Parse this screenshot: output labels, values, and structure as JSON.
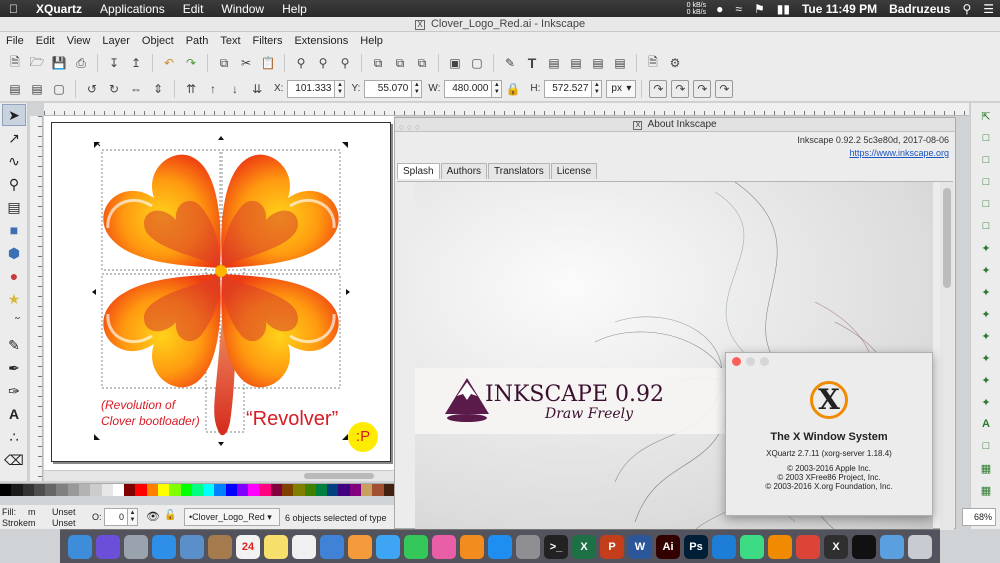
{
  "mac_menubar": {
    "apple_icon": "apple-logo-icon",
    "app_name": "XQuartz",
    "items": [
      "Applications",
      "Edit",
      "Window",
      "Help"
    ],
    "net_up": "0 kB/s",
    "net_down": "0 kB/s",
    "datetime": "Tue 11:49 PM",
    "user": "Badruzeus"
  },
  "window_title": "Clover_Logo_Red.ai - Inkscape",
  "menu": [
    "File",
    "Edit",
    "View",
    "Layer",
    "Object",
    "Path",
    "Text",
    "Filters",
    "Extensions",
    "Help"
  ],
  "controls": {
    "x_label": "X:",
    "x_value": "101.333",
    "y_label": "Y:",
    "y_value": "55.070",
    "w_label": "W:",
    "w_value": "480.000",
    "h_label": "H:",
    "h_value": "572.527",
    "unit": "px"
  },
  "canvas": {
    "caption_line1": "(Revolution of",
    "caption_line2": "Clover bootloader)",
    "revolver": "“Revolver”",
    "smiley": ":P",
    "colors": {
      "petal_outer": "#f03e14",
      "petal_inner": "#ffc107",
      "text_red": "#d81b25",
      "smiley_bg": "#ffeb00"
    }
  },
  "statusbar": {
    "fill_label": "Fill:",
    "fill_value": "m",
    "fill_unset": "Unset",
    "stroke_label": "Stroke:",
    "stroke_value": "m",
    "stroke_unset": "Unset",
    "opacity_label": "O:",
    "opacity_value": "0",
    "layer": "•Clover_Logo_Red",
    "message": "6 objects selected of type"
  },
  "zoom": "68%",
  "about": {
    "title": "About Inkscape",
    "version": "Inkscape 0.92.2 5c3e80d, 2017-08-06",
    "url": "https://www.inkscape.org",
    "tabs": [
      "Splash",
      "Authors",
      "Translators",
      "License"
    ],
    "splash_name": "INKSCAPE 0.92",
    "splash_tagline": "Draw Freely"
  },
  "xquartz": {
    "title": "The X Window System",
    "version": "XQuartz 2.7.11 (xorg-server 1.18.4)",
    "copyright1": "© 2003-2016 Apple Inc.",
    "copyright2": "© 2003 XFree86 Project, Inc.",
    "copyright3": "© 2003-2016 X.org Foundation, Inc."
  },
  "dock": [
    {
      "name": "finder-icon",
      "label": "",
      "color": "#3d8ddb"
    },
    {
      "name": "siri-icon",
      "label": "",
      "color": "#6b4fd8"
    },
    {
      "name": "launchpad-icon",
      "label": "",
      "color": "#9aa2ad"
    },
    {
      "name": "safari-icon",
      "label": "",
      "color": "#2d8fe8"
    },
    {
      "name": "preview-icon",
      "label": "",
      "color": "#5a8fc9"
    },
    {
      "name": "contacts-icon",
      "label": "",
      "color": "#a57b4e"
    },
    {
      "name": "calendar-icon",
      "label": "24",
      "color": "#f2f2f2"
    },
    {
      "name": "notes-icon",
      "label": "",
      "color": "#f6e06b"
    },
    {
      "name": "reminders-icon",
      "label": "",
      "color": "#f0f0f0"
    },
    {
      "name": "keynote-icon",
      "label": "",
      "color": "#3f82d6"
    },
    {
      "name": "photos-icon",
      "label": "",
      "color": "#f59a3b"
    },
    {
      "name": "messages-icon",
      "label": "",
      "color": "#3da5f4"
    },
    {
      "name": "facetime-icon",
      "label": "",
      "color": "#34c759"
    },
    {
      "name": "itunes-icon",
      "label": "",
      "color": "#e85fa8"
    },
    {
      "name": "ibooks-icon",
      "label": "",
      "color": "#f28c1e"
    },
    {
      "name": "appstore-icon",
      "label": "",
      "color": "#1f8ef1"
    },
    {
      "name": "system-preferences-icon",
      "label": "",
      "color": "#8e8e93"
    },
    {
      "name": "terminal-icon",
      "label": ">_",
      "color": "#222222"
    },
    {
      "name": "excel-icon",
      "label": "X",
      "color": "#1e7145"
    },
    {
      "name": "powerpoint-icon",
      "label": "P",
      "color": "#c43e1c"
    },
    {
      "name": "word-icon",
      "label": "W",
      "color": "#2b579a"
    },
    {
      "name": "illustrator-icon",
      "label": "Ai",
      "color": "#330000"
    },
    {
      "name": "photoshop-icon",
      "label": "Ps",
      "color": "#001e36"
    },
    {
      "name": "xcode-icon",
      "label": "",
      "color": "#1c7ed6"
    },
    {
      "name": "android-studio-icon",
      "label": "",
      "color": "#3ddc84"
    },
    {
      "name": "vlc-icon",
      "label": "",
      "color": "#f08a00"
    },
    {
      "name": "chrome-icon",
      "label": "",
      "color": "#db4437"
    },
    {
      "name": "xquartz-icon",
      "label": "X",
      "color": "#2f2f2f"
    },
    {
      "name": "inkscape-icon",
      "label": "",
      "color": "#111111"
    },
    {
      "name": "downloads-icon",
      "label": "",
      "color": "#5aa0e0"
    },
    {
      "name": "trash-icon",
      "label": "",
      "color": "#c8ccd2"
    }
  ]
}
